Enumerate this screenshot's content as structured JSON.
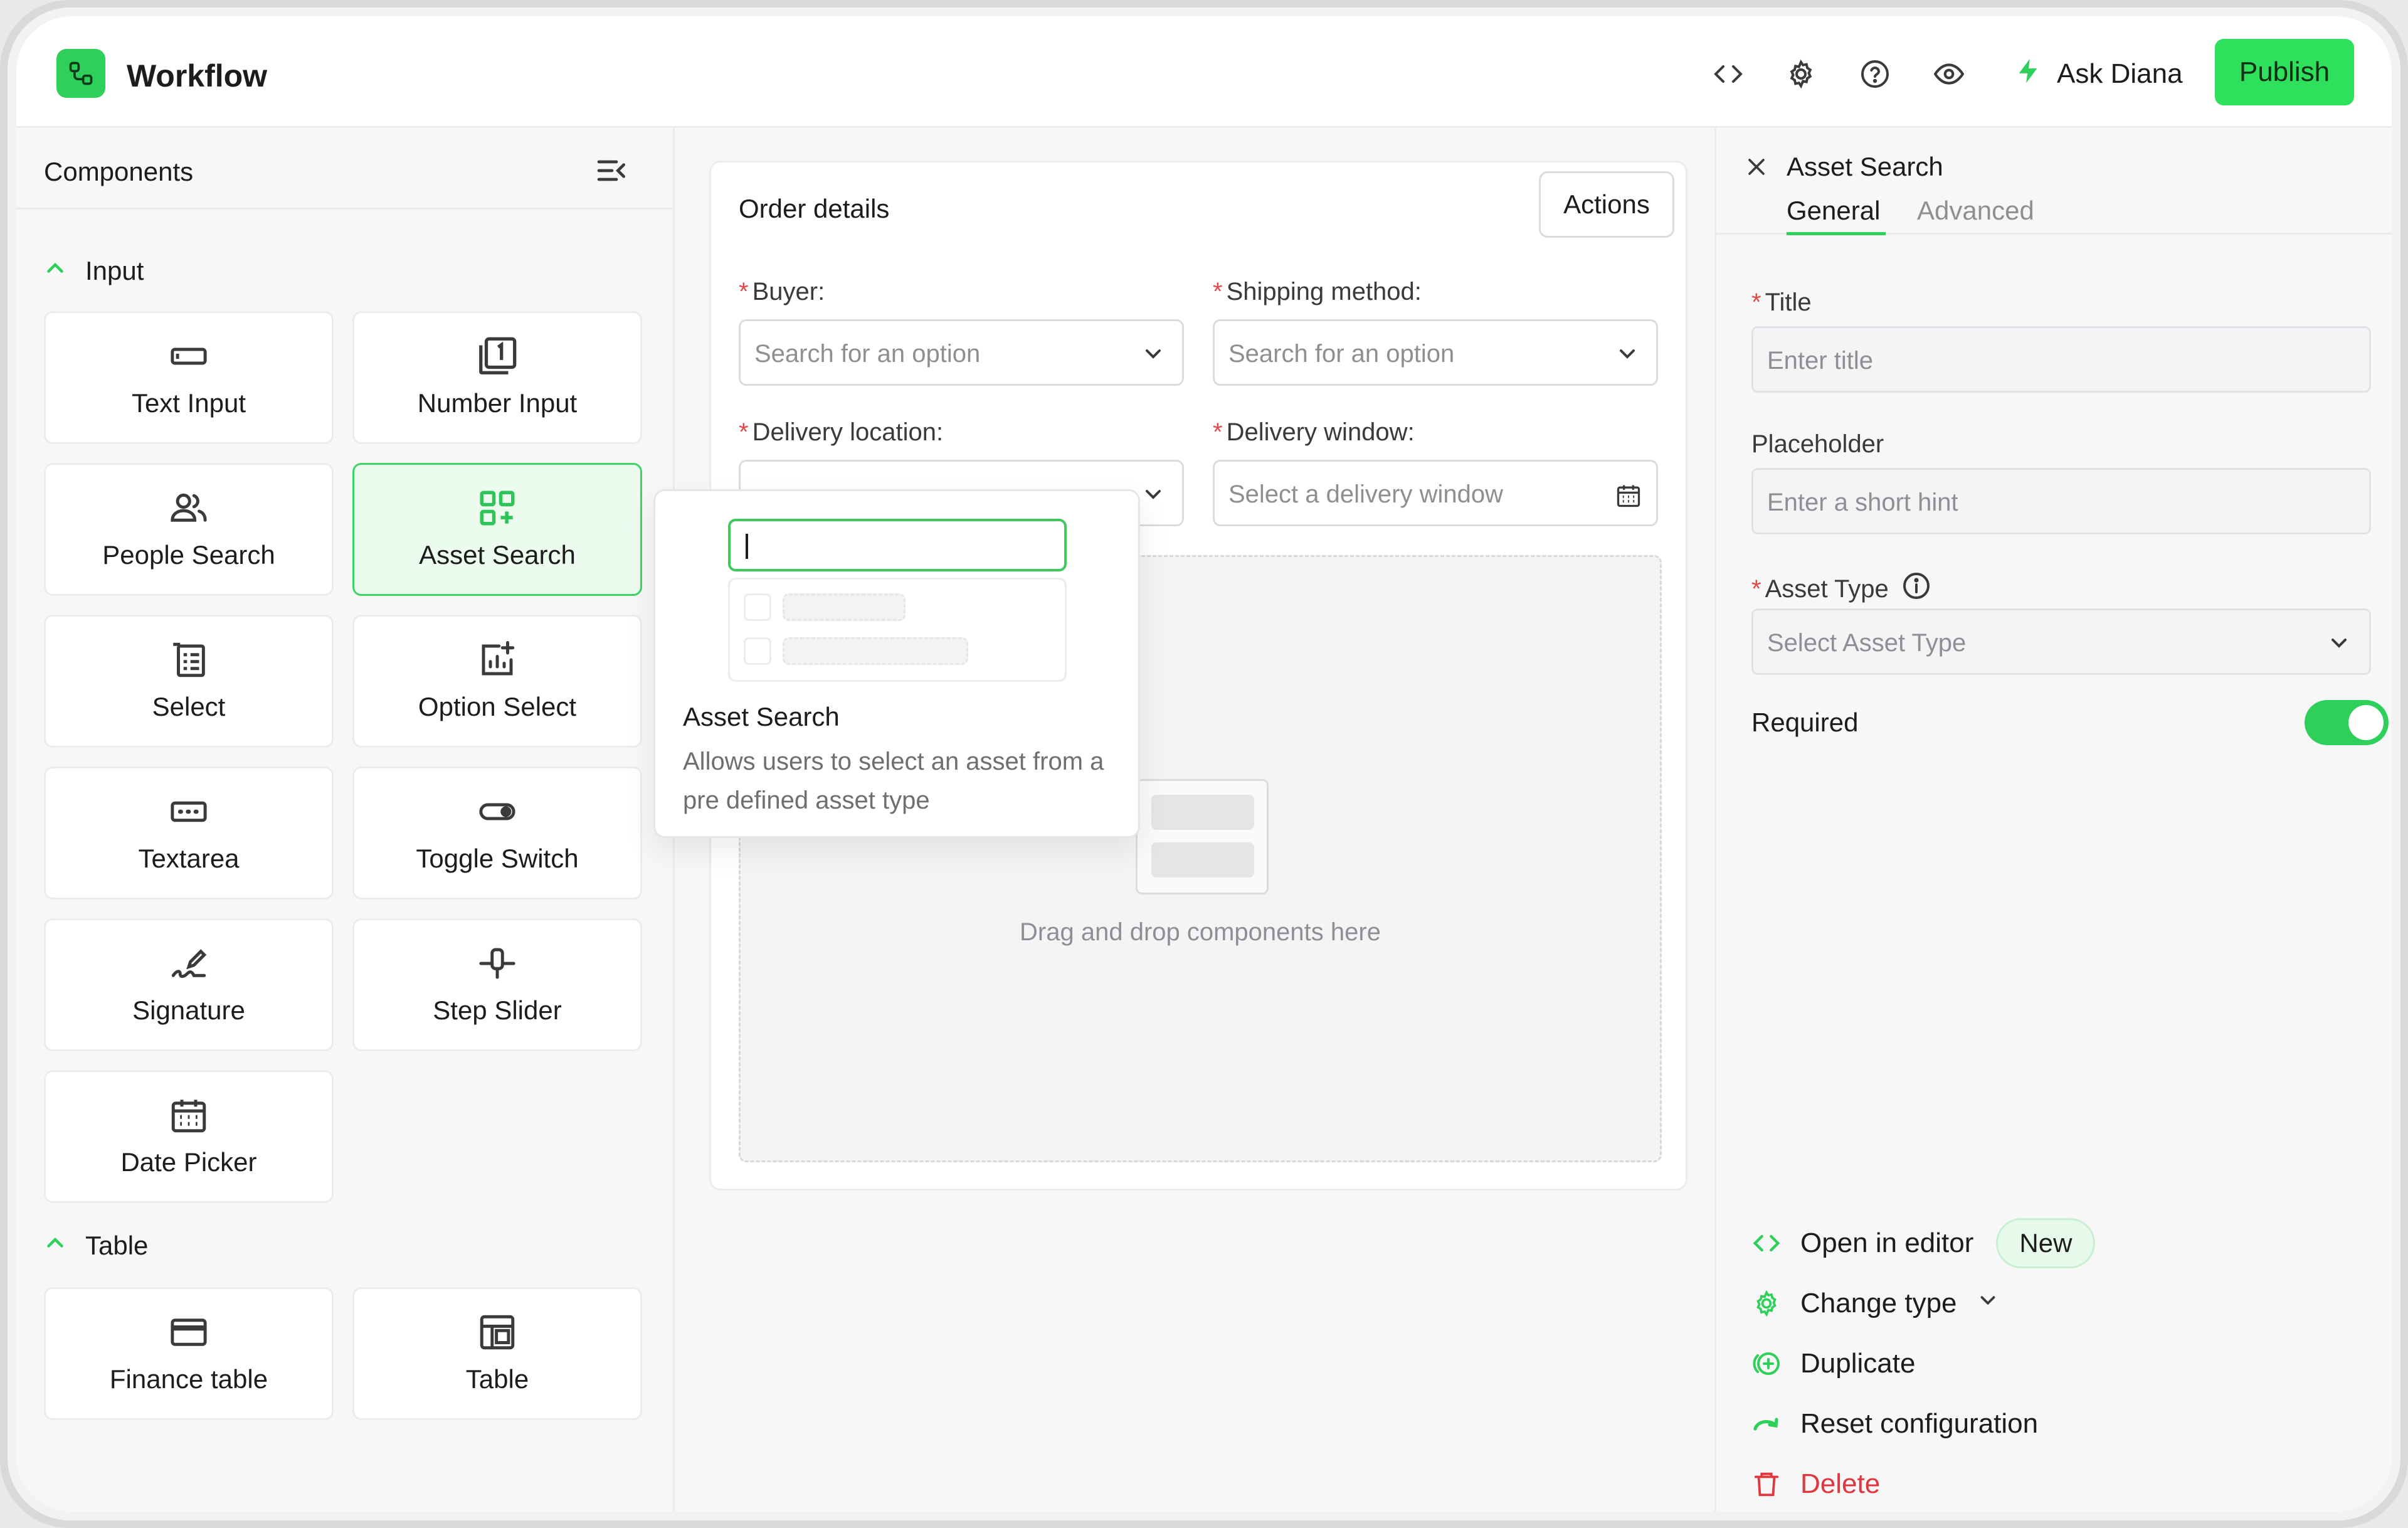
{
  "header": {
    "app_title": "Workflow",
    "ask_label": "Ask Diana",
    "publish_label": "Publish",
    "icons": [
      "code-icon",
      "gear-icon",
      "help-icon",
      "eye-icon",
      "lightning-icon"
    ]
  },
  "left_panel": {
    "title": "Components",
    "sections": [
      {
        "label": "Input",
        "items": [
          {
            "label": "Text Input",
            "icon": "text-input-icon"
          },
          {
            "label": "Number Input",
            "icon": "number-input-icon"
          },
          {
            "label": "People Search",
            "icon": "people-icon"
          },
          {
            "label": "Asset Search",
            "icon": "asset-grid-icon",
            "active": true
          },
          {
            "label": "Select",
            "icon": "select-list-icon"
          },
          {
            "label": "Option Select",
            "icon": "option-chart-icon"
          },
          {
            "label": "Textarea",
            "icon": "textarea-icon"
          },
          {
            "label": "Toggle Switch",
            "icon": "toggle-icon"
          },
          {
            "label": "Signature",
            "icon": "signature-icon"
          },
          {
            "label": "Step Slider",
            "icon": "slider-icon"
          },
          {
            "label": "Date Picker",
            "icon": "calendar-icon"
          }
        ]
      },
      {
        "label": "Table",
        "items": [
          {
            "label": "Finance table",
            "icon": "card-icon"
          },
          {
            "label": "Table",
            "icon": "table-icon"
          }
        ]
      }
    ]
  },
  "form": {
    "title": "Order details",
    "actions_label": "Actions",
    "fields": {
      "buyer": {
        "label": "Buyer:",
        "placeholder": "Search for an option"
      },
      "shipping": {
        "label": "Shipping method:",
        "placeholder": "Search for an option"
      },
      "delivery_location": {
        "label": "Delivery location:"
      },
      "delivery_window": {
        "label": "Delivery window:",
        "placeholder": "Select a delivery window"
      }
    },
    "dropzone_text": "Drag and drop components here"
  },
  "popover": {
    "title": "Asset Search",
    "description": "Allows users to select an asset from a pre defined asset type"
  },
  "right_panel": {
    "title": "Asset Search",
    "tabs": [
      "General",
      "Advanced"
    ],
    "title_field": {
      "label": "Title",
      "placeholder": "Enter title"
    },
    "placeholder_field": {
      "label": "Placeholder",
      "placeholder": "Enter a short hint"
    },
    "asset_type_field": {
      "label": "Asset Type",
      "placeholder": "Select Asset Type"
    },
    "required_label": "Required",
    "required_on": true,
    "actions": {
      "open_editor": "Open in editor",
      "new_badge": "New",
      "change_type": "Change type",
      "duplicate": "Duplicate",
      "reset": "Reset configuration",
      "delete": "Delete"
    }
  },
  "colors": {
    "accent": "#2fd05a",
    "danger": "#e0373f",
    "required": "#e14a4a"
  }
}
